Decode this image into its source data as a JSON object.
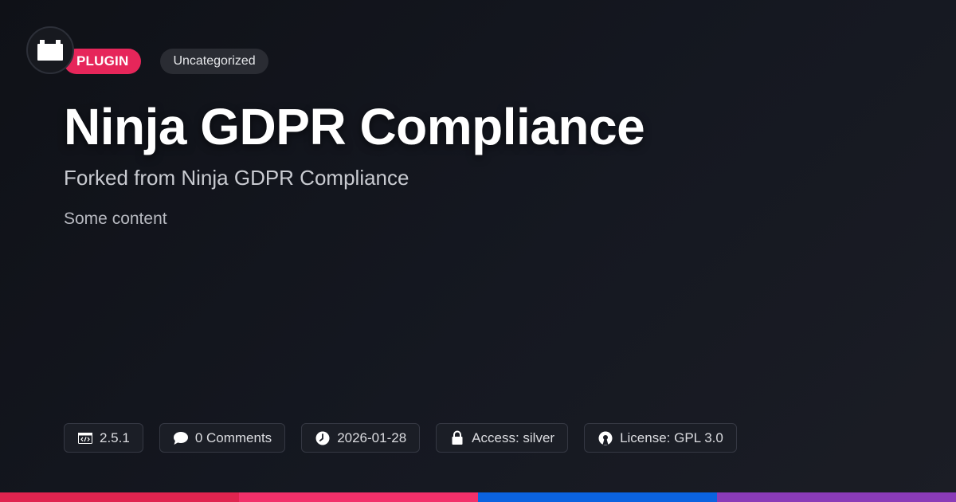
{
  "header": {
    "logo_icon": "plugin-block-icon",
    "type_tag": "PLUGIN",
    "category_tag": "Uncategorized"
  },
  "main": {
    "title": "Ninja GDPR Compliance",
    "subtitle": "Forked from Ninja GDPR Compliance",
    "content": "Some content"
  },
  "meta": {
    "version": "2.5.1",
    "comments": "0 Comments",
    "date": "2026-01-28",
    "access": "Access: silver",
    "license": "License: GPL 3.0"
  },
  "colors": {
    "accent": "#e6265a",
    "bar": [
      "#e0244f",
      "#f2306a",
      "#0b63e0",
      "#8a3bb8"
    ]
  }
}
